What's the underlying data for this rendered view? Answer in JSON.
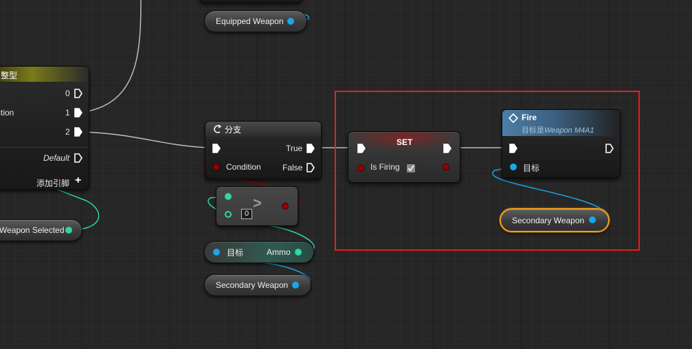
{
  "colors": {
    "exec_wire": "#bfbfbf",
    "object_wire": "#1aa6ea",
    "integer_wire": "#2ed6a6",
    "boolean_wire": "#9a0000",
    "highlight_frame": "#e42020",
    "selected_outline": "#f0a020"
  },
  "switch_node": {
    "title": "整型",
    "input_label": "ction",
    "outputs": [
      "0",
      "1",
      "2"
    ],
    "default_label": "Default",
    "add_pin_label": "添加引脚",
    "add_pin_icon": "plus-icon"
  },
  "equipped_weapon_getter": {
    "label": "Equipped Weapon"
  },
  "weapon_selected_getter": {
    "label": "Weapon Selected"
  },
  "branch_node": {
    "title": "分支",
    "icon": "branch-icon",
    "true_label": "True",
    "condition_label": "Condition",
    "false_label": "False"
  },
  "compare_node": {
    "symbol": ">",
    "literal_value": "0"
  },
  "ammo_getter": {
    "target_label": "目标",
    "output_label": "Ammo"
  },
  "secondary_weapon_getter": {
    "label": "Secondary Weapon"
  },
  "set_node": {
    "title": "SET",
    "var_label": "Is Firing",
    "checked": true
  },
  "fire_node": {
    "title": "Fire",
    "icon": "function-icon",
    "subtitle_prefix": "目标是",
    "subtitle_class": "Weapon M4A1",
    "target_label": "目标"
  },
  "secondary_weapon_getter_selected": {
    "label": "Secondary Weapon"
  }
}
